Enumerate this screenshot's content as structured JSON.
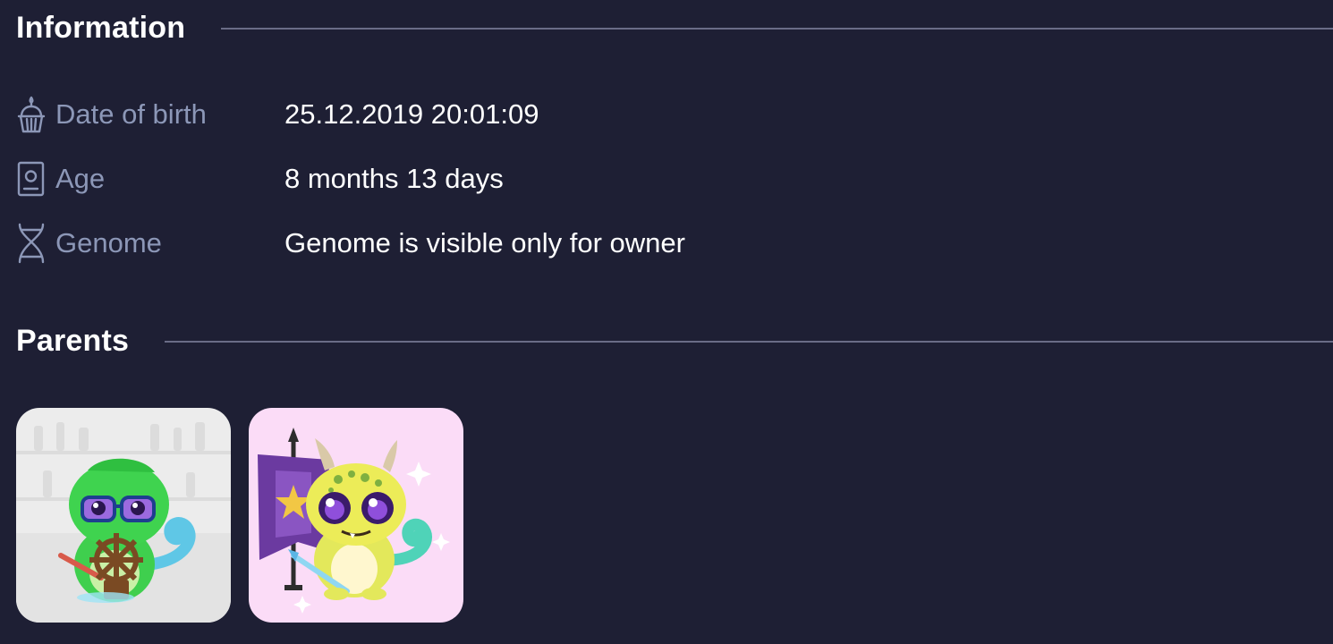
{
  "sections": {
    "information_title": "Information",
    "parents_title": "Parents"
  },
  "info": {
    "rows": [
      {
        "icon": "cupcake-icon",
        "label": "Date of birth",
        "value": "25.12.2019 20:01:09"
      },
      {
        "icon": "id-card-icon",
        "label": "Age",
        "value": "8 months 13 days"
      },
      {
        "icon": "dna-icon",
        "label": "Genome",
        "value": "Genome is visible only for owner"
      }
    ]
  },
  "parents": [
    {
      "icon": "chameleon-helm-avatar-icon",
      "background": "#ececec"
    },
    {
      "icon": "chameleon-banner-avatar-icon",
      "background": "#fbdcf7"
    }
  ],
  "colors": {
    "background": "#1e1f34",
    "label": "#8c97b7",
    "text": "#ffffff",
    "rule": "#6a6c86"
  }
}
